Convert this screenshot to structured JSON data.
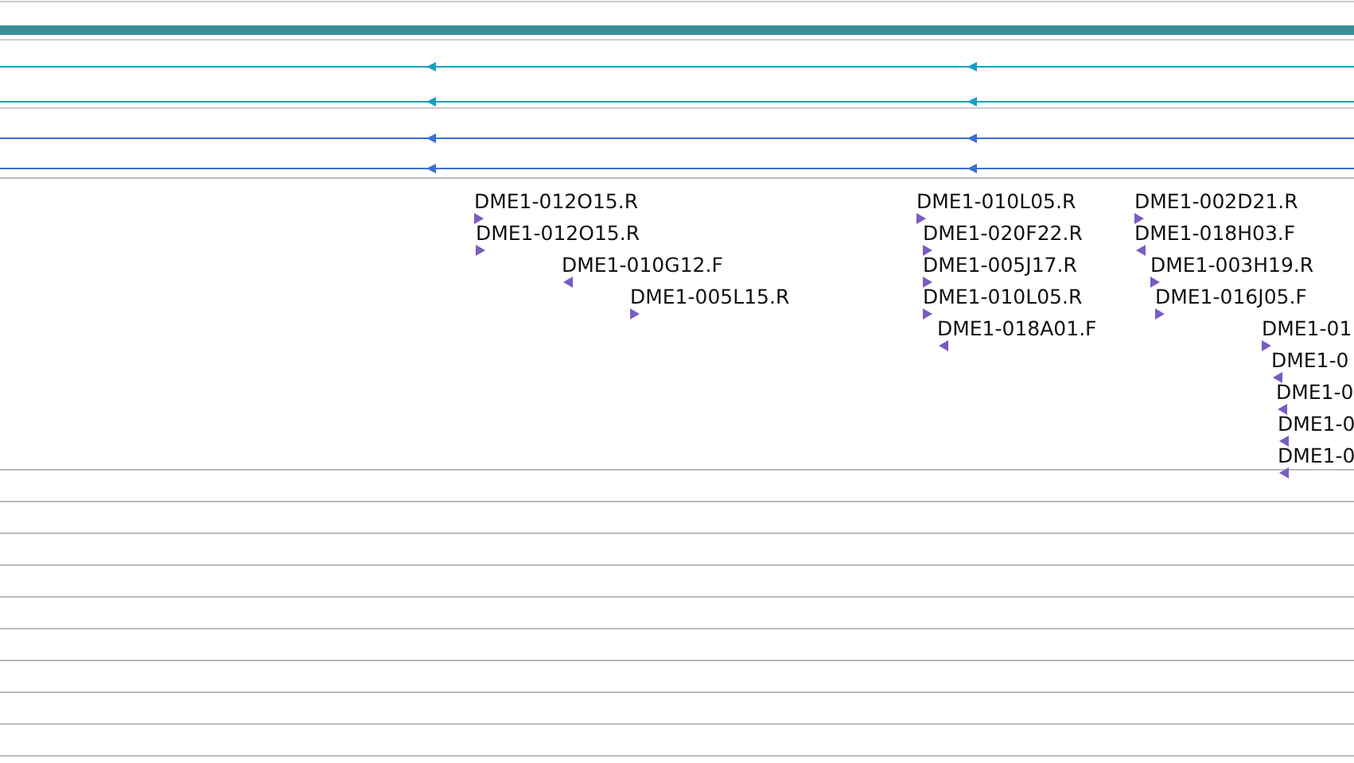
{
  "transcripts": [
    {
      "reverse": true,
      "color": "#1a9fc0"
    },
    {
      "reverse": true,
      "color": "#1a9fc0"
    },
    {
      "reverse": true,
      "color": "#3a6fd0"
    },
    {
      "reverse": true,
      "color": "#3a6fd0"
    }
  ],
  "features": [
    {
      "label": "DME1-012O15.R",
      "reverse": false
    },
    {
      "label": "DME1-010L05.R",
      "reverse": false
    },
    {
      "label": "DME1-002D21.R",
      "reverse": false
    },
    {
      "label": "DME1-012O15.R",
      "reverse": false
    },
    {
      "label": "DME1-020F22.R",
      "reverse": false
    },
    {
      "label": "DME1-018H03.F",
      "reverse": true
    },
    {
      "label": "DME1-010G12.F",
      "reverse": true
    },
    {
      "label": "DME1-005J17.R",
      "reverse": false
    },
    {
      "label": "DME1-003H19.R",
      "reverse": false
    },
    {
      "label": "DME1-005L15.R",
      "reverse": false
    },
    {
      "label": "DME1-010L05.R",
      "reverse": false
    },
    {
      "label": "DME1-016J05.F",
      "reverse": false
    },
    {
      "label": "DME1-018A01.F",
      "reverse": true
    },
    {
      "label": "DME1-01",
      "reverse": false
    },
    {
      "label": "DME1-0",
      "reverse": true
    },
    {
      "label": "DME1-0",
      "reverse": true
    },
    {
      "label": "DME1-0",
      "reverse": true
    },
    {
      "label": "DME1-0",
      "reverse": true
    }
  ]
}
